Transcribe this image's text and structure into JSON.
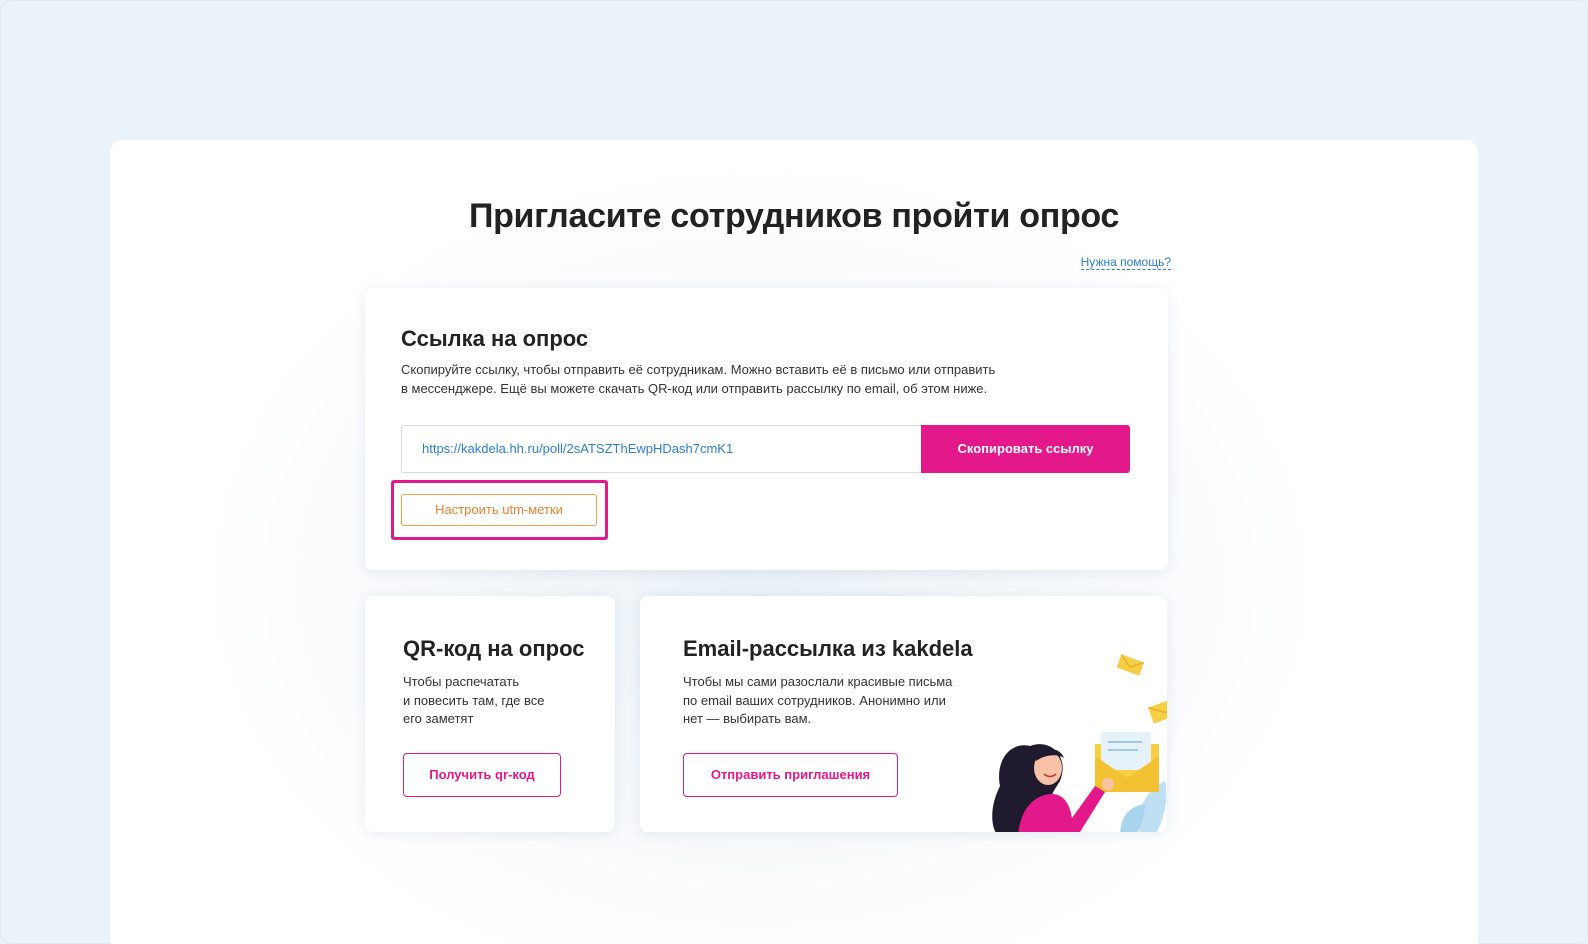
{
  "page": {
    "title": "Пригласите сотрудников пройти опрос",
    "help_link": "Нужна помощь?"
  },
  "link_card": {
    "title": "Ссылка на опрос",
    "description_line1": "Скопируйте ссылку, чтобы отправить её сотрудникам. Можно вставить её в письмо или отправить",
    "description_line2": "в мессенджере. Ещё вы можете скачать QR-код или отправить рассылку по email, об этом ниже.",
    "url": "https://kakdela.hh.ru/poll/2sATSZThEwpHDash7cmK1",
    "copy_button": "Скопировать ссылку",
    "utm_button": "Настроить utm-метки"
  },
  "qr_card": {
    "title": "QR-код на опрос",
    "text_line1": "Чтобы распечатать",
    "text_line2": "и повесить там, где все",
    "text_line3": "его заметят",
    "button": "Получить qr-код"
  },
  "email_card": {
    "title": "Email-рассылка из kakdela",
    "text_line1": "Чтобы мы сами разослали красивые письма",
    "text_line2": "по email ваших сотрудников. Анонимно или",
    "text_line3": "нет — выбирать вам.",
    "button": "Отправить приглашения"
  },
  "colors": {
    "accent": "#e3198b",
    "link": "#2a7fd4",
    "utm_orange": "#e8822d",
    "background": "#e9f3f9"
  }
}
